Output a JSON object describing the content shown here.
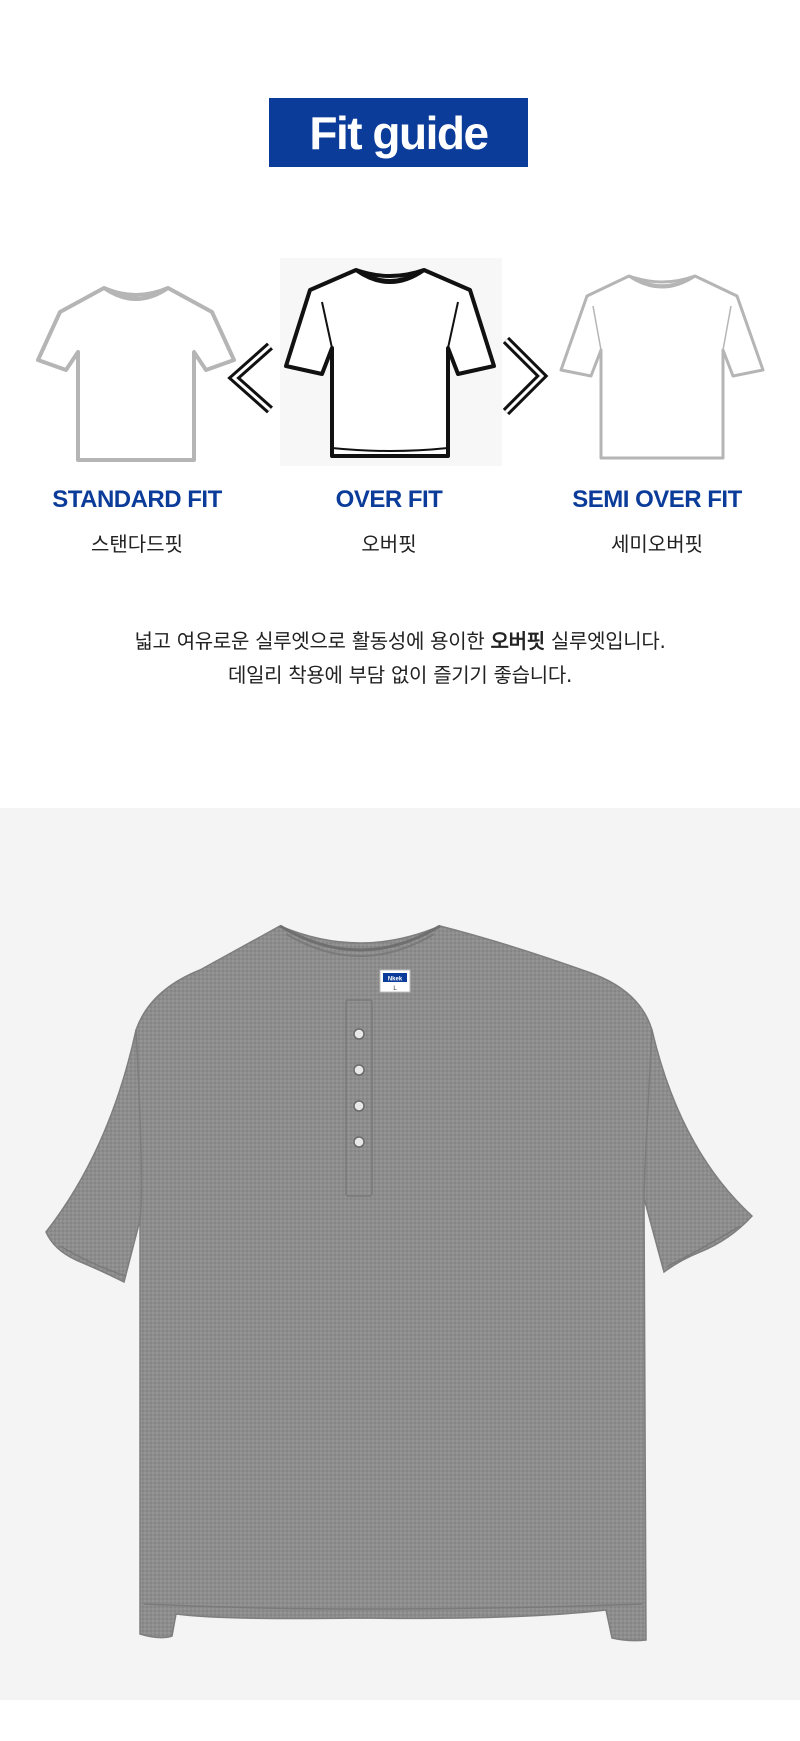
{
  "header": {
    "title": "Fit guide"
  },
  "fits": [
    {
      "name_en": "STANDARD FIT",
      "name_kr": "스탠다드핏"
    },
    {
      "name_en": "OVER FIT",
      "name_kr": "오버핏"
    },
    {
      "name_en": "SEMI OVER FIT",
      "name_kr": "세미오버핏"
    }
  ],
  "description": {
    "line1_before": "넓고 여유로운 실루엣으로 활동성에 용이한 ",
    "line1_bold": "오버핏",
    "line1_after": " 실루엣입니다.",
    "line2": "데일리 착용에 부담 없이 즐기기 좋습니다."
  },
  "product": {
    "tag_text": "Nkek",
    "tag_size": "L",
    "shirt_color": "#8d8d8d"
  },
  "colors": {
    "brand_blue": "#0c3c9a",
    "photo_background": "#f4f4f4"
  }
}
